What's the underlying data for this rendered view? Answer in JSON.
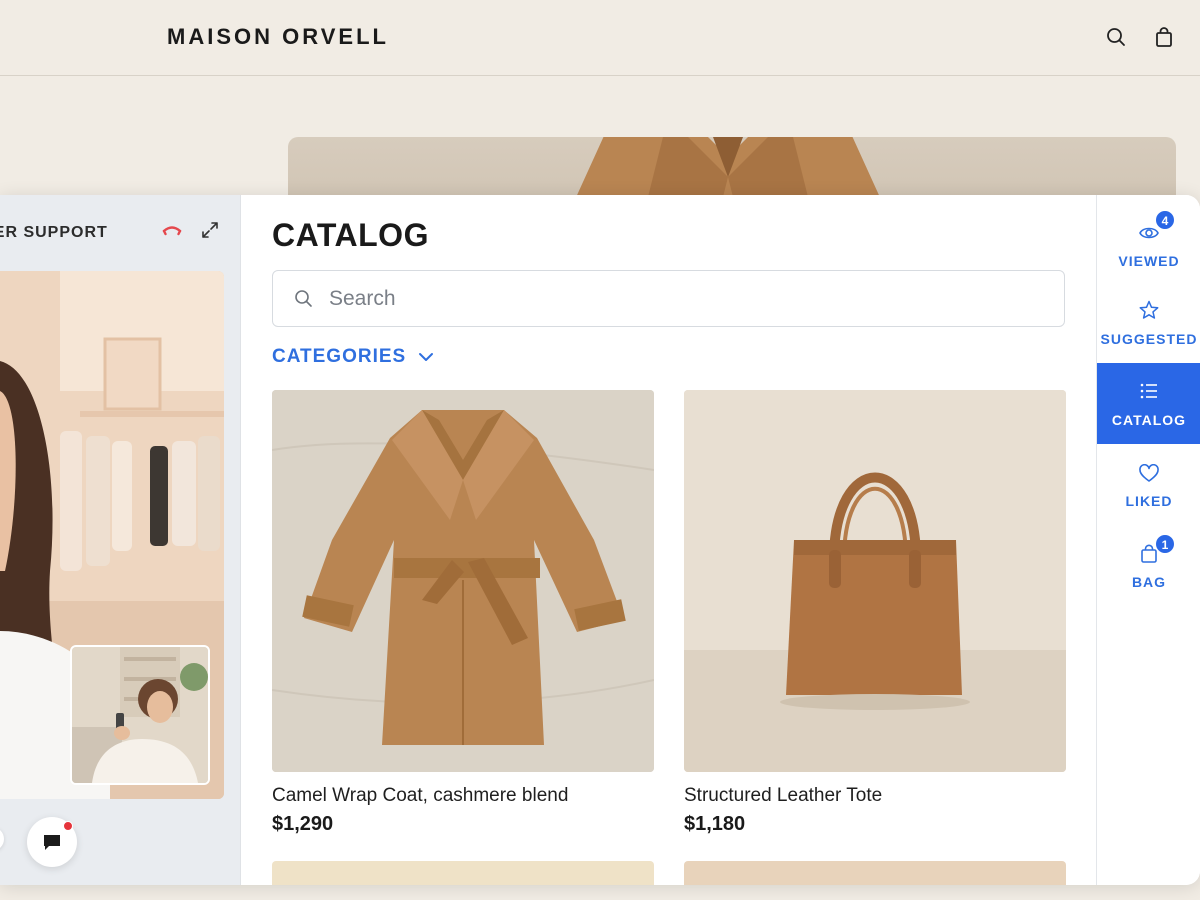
{
  "header": {
    "brand": "MAISON ORVELL",
    "search_icon": "search-icon",
    "bag_icon": "shopping-bag-icon"
  },
  "video_panel": {
    "title": "OMER SUPPORT",
    "hangup_icon": "phone-hangup-icon",
    "expand_icon": "expand-icon",
    "chat_icon": "chat-bubble-icon",
    "chat_notification": true
  },
  "catalog": {
    "title": "CATALOG",
    "search_placeholder": "Search",
    "categories_label": "CATEGORIES",
    "products": [
      {
        "name": "Camel Wrap Coat, cashmere blend",
        "price": "$1,290"
      },
      {
        "name": "Structured Leather Tote",
        "price": "$1,180"
      }
    ]
  },
  "rail": {
    "items": [
      {
        "label": "VIEWED",
        "icon": "eye-icon",
        "badge": "4"
      },
      {
        "label": "SUGGESTED",
        "icon": "star-icon"
      },
      {
        "label": "CATALOG",
        "icon": "list-icon",
        "active": true
      },
      {
        "label": "LIKED",
        "icon": "heart-icon"
      },
      {
        "label": "BAG",
        "icon": "shopping-bag-icon",
        "badge": "1"
      }
    ]
  },
  "colors": {
    "accent": "#2a67e6",
    "page_background": "#f1ece4",
    "notification": "#e5343b"
  }
}
